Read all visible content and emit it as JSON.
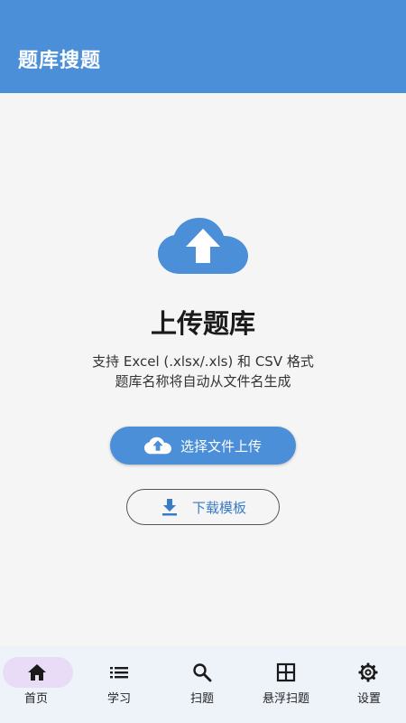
{
  "app_bar": {
    "title": "题库搜题",
    "background_color": "#4a8fd8"
  },
  "upload_panel": {
    "icon": "cloud-upload-icon",
    "heading": "上传题库",
    "description_line1": "支持 Excel (.xlsx/.xls) 和 CSV 格式",
    "description_line2": "题库名称将自动从文件名生成",
    "primary_button": {
      "label": "选择文件上传",
      "icon": "cloud-upload-icon"
    },
    "secondary_button": {
      "label": "下载模板",
      "icon": "download-icon"
    }
  },
  "bottom_nav": {
    "active_color": "#e8dcf6",
    "items": [
      {
        "label": "首页",
        "icon": "home-icon",
        "active": true
      },
      {
        "label": "学习",
        "icon": "list-icon",
        "active": false
      },
      {
        "label": "扫题",
        "icon": "search-icon",
        "active": false
      },
      {
        "label": "悬浮扫题",
        "icon": "grid-icon",
        "active": false
      },
      {
        "label": "设置",
        "icon": "gear-icon",
        "active": false
      }
    ]
  }
}
